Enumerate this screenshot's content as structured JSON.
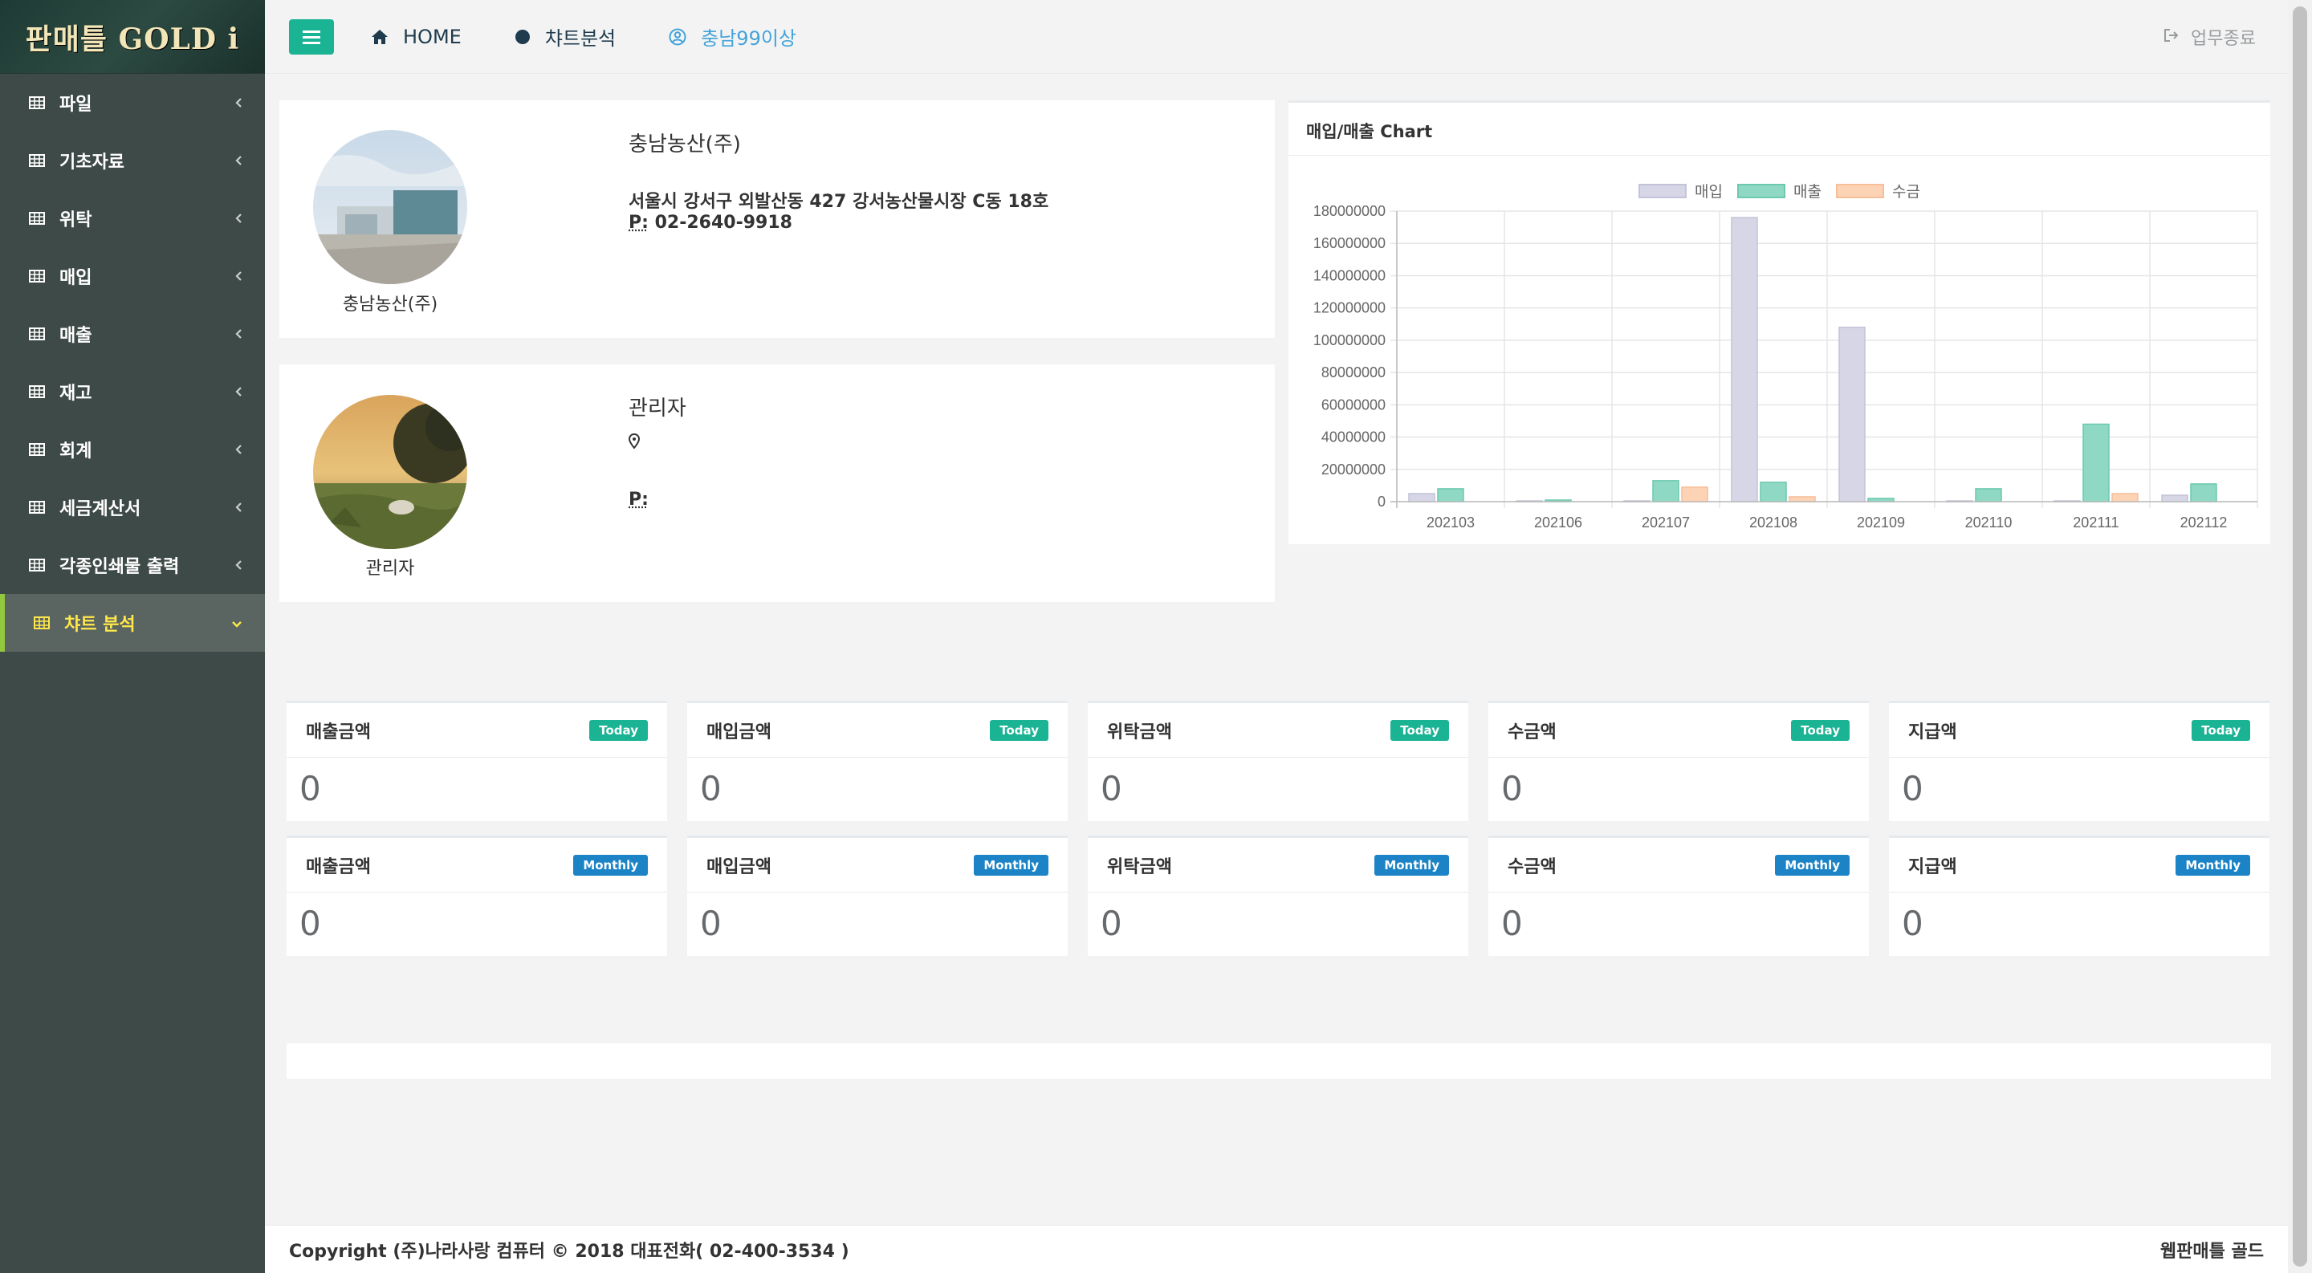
{
  "app": {
    "logo_text": "판매틀 GOLD i"
  },
  "sidebar": {
    "items": [
      {
        "label": "파일",
        "active": false
      },
      {
        "label": "기초자료",
        "active": false
      },
      {
        "label": "위탁",
        "active": false
      },
      {
        "label": "매입",
        "active": false
      },
      {
        "label": "매출",
        "active": false
      },
      {
        "label": "재고",
        "active": false
      },
      {
        "label": "회계",
        "active": false
      },
      {
        "label": "세금계산서",
        "active": false
      },
      {
        "label": "각종인쇄물 출력",
        "active": false
      },
      {
        "label": "챠트 분석",
        "active": true
      }
    ]
  },
  "topbar": {
    "home_label": "HOME",
    "chart_label": "챠트분석",
    "user_label": "충남99이상",
    "logout_label": "업무종료"
  },
  "company": {
    "name": "충남농산(주)",
    "avatar_caption": "충남농산(주)",
    "address": "서울시 강서구 외발산동 427 강서농산물시장 C동 18호",
    "phone_prefix": "P:",
    "phone": "02-2640-9918"
  },
  "manager": {
    "name": "관리자",
    "avatar_caption": "관리자",
    "phone_prefix": "P:"
  },
  "chart_card": {
    "title": "매입/매출 Chart"
  },
  "chart_data": {
    "type": "bar",
    "categories": [
      "202103",
      "202106",
      "202107",
      "202108",
      "202109",
      "202110",
      "202111",
      "202112"
    ],
    "series": [
      {
        "name": "매입",
        "values": [
          5000000,
          500000,
          500000,
          176000000,
          108000000,
          500000,
          500000,
          4000000
        ],
        "color": "#d6d6e6",
        "border": "#c3c3d9"
      },
      {
        "name": "매출",
        "values": [
          8000000,
          1000000,
          13000000,
          12000000,
          2000000,
          8000000,
          48000000,
          11000000
        ],
        "color": "#8fd9c4",
        "border": "#6cc9ae"
      },
      {
        "name": "수금",
        "values": [
          0,
          0,
          9000000,
          3000000,
          0,
          0,
          5000000,
          0
        ],
        "color": "#fdd3b5",
        "border": "#f7bf98"
      }
    ],
    "ylim": [
      0,
      180000000
    ],
    "yticks": [
      "180000000",
      "160000000",
      "140000000",
      "120000000",
      "100000000",
      "80000000",
      "60000000",
      "40000000",
      "20000000",
      "0"
    ],
    "grid": true,
    "legend": "top-center"
  },
  "stats": {
    "today": [
      {
        "label": "매출금액",
        "badge": "Today",
        "value": "0"
      },
      {
        "label": "매입금액",
        "badge": "Today",
        "value": "0"
      },
      {
        "label": "위탁금액",
        "badge": "Today",
        "value": "0"
      },
      {
        "label": "수금액",
        "badge": "Today",
        "value": "0"
      },
      {
        "label": "지급액",
        "badge": "Today",
        "value": "0"
      }
    ],
    "monthly": [
      {
        "label": "매출금액",
        "badge": "Monthly",
        "value": "0"
      },
      {
        "label": "매입금액",
        "badge": "Monthly",
        "value": "0"
      },
      {
        "label": "위탁금액",
        "badge": "Monthly",
        "value": "0"
      },
      {
        "label": "수금액",
        "badge": "Monthly",
        "value": "0"
      },
      {
        "label": "지급액",
        "badge": "Monthly",
        "value": "0"
      }
    ]
  },
  "footer": {
    "copyright": "Copyright (주)나라사랑 컴퓨터 © 2018 대표전화( 02-400-3534 )",
    "brand": "웹판매틀 골드"
  }
}
